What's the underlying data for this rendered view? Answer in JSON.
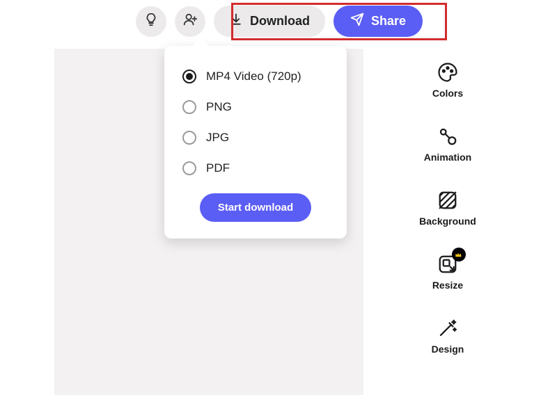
{
  "toolbar": {
    "download_label": "Download",
    "share_label": "Share"
  },
  "dropdown": {
    "options": [
      {
        "label": "MP4 Video (720p)",
        "selected": true
      },
      {
        "label": "PNG",
        "selected": false
      },
      {
        "label": "JPG",
        "selected": false
      },
      {
        "label": "PDF",
        "selected": false
      }
    ],
    "start_label": "Start download"
  },
  "side_panel": {
    "items": [
      {
        "label": "Colors"
      },
      {
        "label": "Animation"
      },
      {
        "label": "Background"
      },
      {
        "label": "Resize"
      },
      {
        "label": "Design"
      }
    ]
  }
}
